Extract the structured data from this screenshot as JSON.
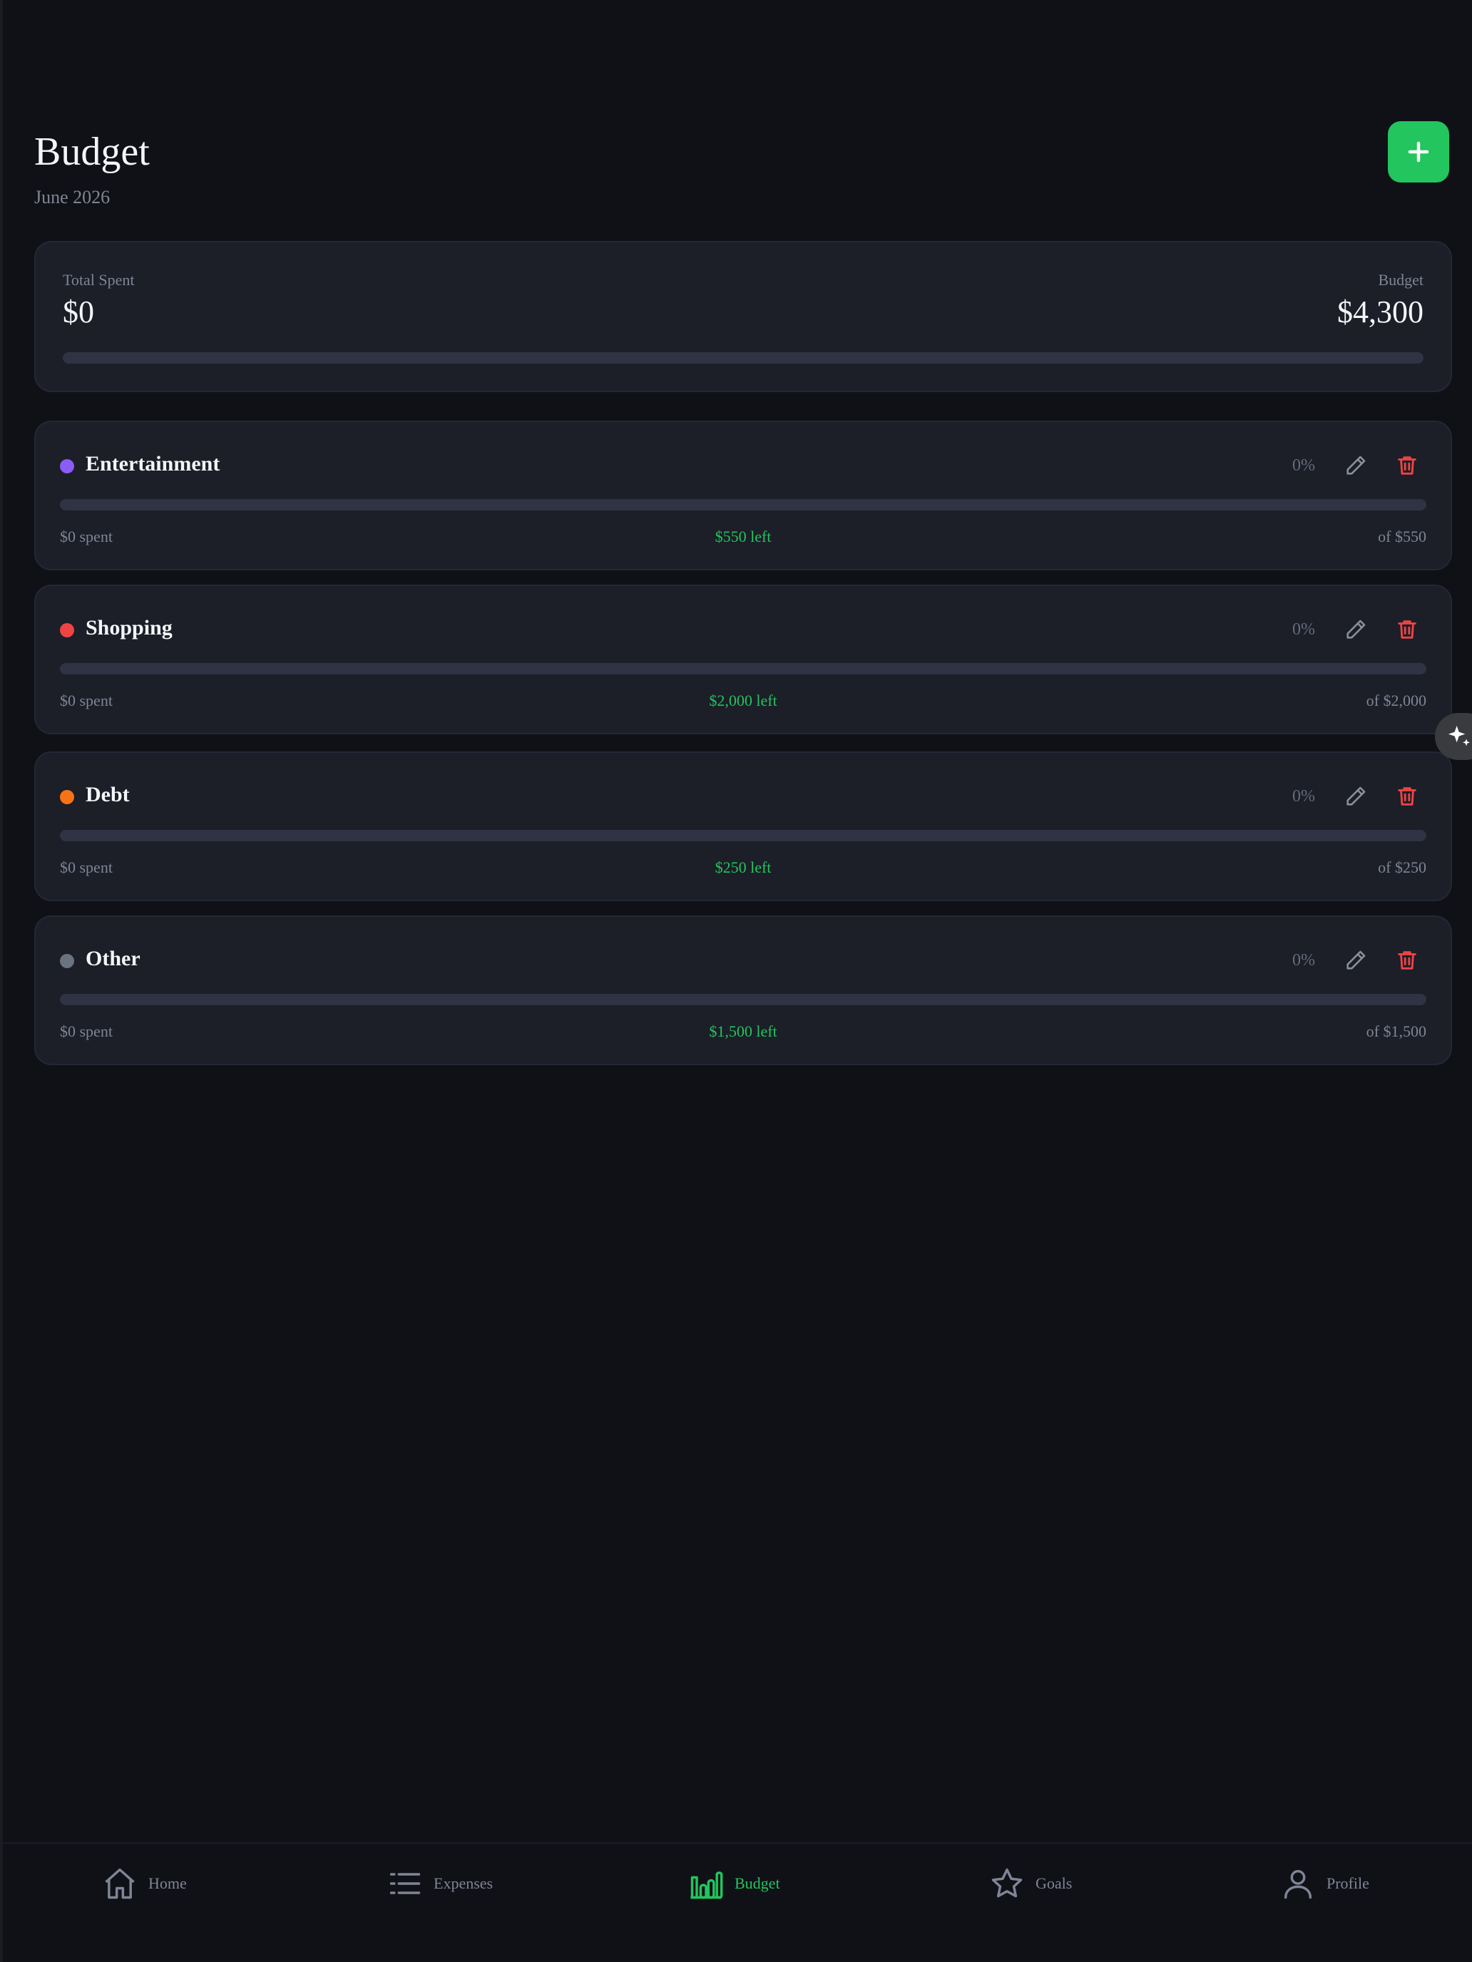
{
  "header": {
    "title": "Budget",
    "subtitle": "June 2026",
    "add_icon": "plus-icon"
  },
  "summary": {
    "spent_label": "Total Spent",
    "spent_value": "$0",
    "budget_label": "Budget",
    "budget_value": "$4,300",
    "progress_fraction": 0
  },
  "categories": [
    {
      "name": "Entertainment",
      "color": "#8b5cf6",
      "percent": "0%",
      "spent": "$0 spent",
      "left": "$550 left",
      "total": "of $550",
      "progress_fraction": 0
    },
    {
      "name": "Shopping",
      "color": "#ef4444",
      "percent": "0%",
      "spent": "$0 spent",
      "left": "$2,000 left",
      "total": "of $2,000",
      "progress_fraction": 0
    },
    {
      "name": "Debt",
      "color": "#f97316",
      "percent": "0%",
      "spent": "$0 spent",
      "left": "$250 left",
      "total": "of $250",
      "progress_fraction": 0
    },
    {
      "name": "Other",
      "color": "#6b7280",
      "percent": "0%",
      "spent": "$0 spent",
      "left": "$1,500 left",
      "total": "of $1,500",
      "progress_fraction": 0
    }
  ],
  "nav": {
    "items": [
      {
        "label": "Home",
        "icon": "home-icon",
        "active": false
      },
      {
        "label": "Expenses",
        "icon": "list-icon",
        "active": false
      },
      {
        "label": "Budget",
        "icon": "bar-chart-icon",
        "active": true
      },
      {
        "label": "Goals",
        "icon": "star-icon",
        "active": false
      },
      {
        "label": "Profile",
        "icon": "user-icon",
        "active": false
      }
    ]
  },
  "colors": {
    "accent": "#22c55e",
    "danger": "#ef4444",
    "background": "#101117",
    "card": "#1c1e28"
  }
}
